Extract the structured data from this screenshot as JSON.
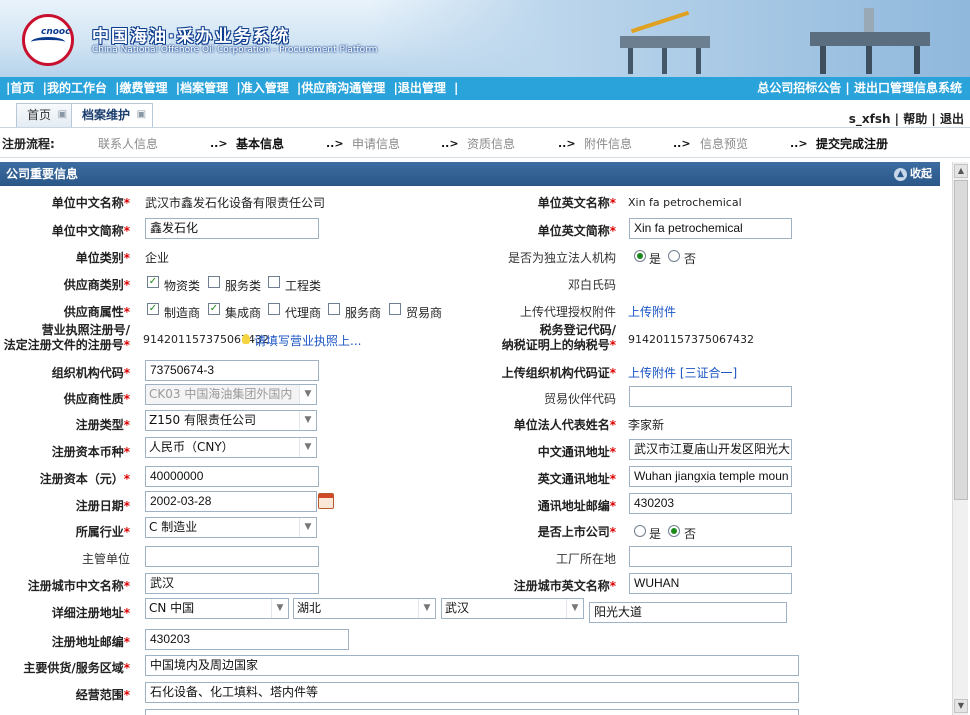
{
  "header": {
    "title_cn": "中国海油·采办业务系统",
    "title_en": "China National Offshore Oil Corporation - Procurement Platform",
    "logo_text": "cnooc"
  },
  "mainnav": {
    "left": [
      "|首页",
      "|我的工作台",
      "|缴费管理",
      "|档案管理",
      "|准入管理",
      "|供应商沟通管理",
      "|退出管理",
      "|"
    ],
    "right": "总公司招标公告 | 进出口管理信息系统"
  },
  "tabs": [
    {
      "label": "首页"
    },
    {
      "label": "档案维护"
    }
  ],
  "userbar": "s_xfsh | 帮助 | 退出",
  "steps": {
    "label": "注册流程:",
    "items": [
      "联系人信息",
      "基本信息",
      "申请信息",
      "资质信息",
      "附件信息",
      "信息预览",
      "提交完成注册"
    ],
    "arrow": "..>"
  },
  "panel": {
    "title": "公司重要信息",
    "collapse": "收起"
  },
  "form": {
    "cn_name_label": "单位中文名称",
    "cn_name_value": "武汉市鑫发石化设备有限责任公司",
    "en_name_label": "单位英文名称",
    "en_name_value": "Xin fa petrochemical",
    "cn_short_label": "单位中文简称",
    "cn_short_value": "鑫发石化",
    "en_short_label": "单位英文简称",
    "en_short_value": "Xin fa petrochemical",
    "unit_type_label": "单位类别",
    "unit_type_value": "企业",
    "independent_label": "是否为独立法人机构",
    "yes": "是",
    "no": "否",
    "supplier_type_label": "供应商类别",
    "type_material": "物资类",
    "type_service": "服务类",
    "type_engineering": "工程类",
    "dengbai_label": "邓白氏码",
    "supplier_attr_label": "供应商属性",
    "attr_manufacturer": "制造商",
    "attr_integrator": "集成商",
    "attr_agent": "代理商",
    "attr_service": "服务商",
    "attr_trade": "贸易商",
    "agent_upload_label": "上传代理授权附件",
    "upload_link": "上传附件",
    "license_label_1": "营业执照注册号/",
    "license_label_2": "法定注册文件的注册号",
    "license_value": "914201157375067432",
    "license_hint": "请填写营业执照上...",
    "tax_label_1": "税务登记代码/",
    "tax_label_2": "纳税证明上的纳税号",
    "tax_value": "914201157375067432",
    "org_code_label": "组织机构代码",
    "org_code_value": "73750674-3",
    "org_upload_label": "上传组织机构代码证",
    "org_upload_link": "上传附件 [三证合一]",
    "supplier_nature_label": "供应商性质",
    "supplier_nature_value": "CK03 中国海油集团外国内",
    "partner_code_label": "贸易伙伴代码",
    "reg_type_label": "注册类型",
    "reg_type_value": "Z150 有限责任公司",
    "legal_rep_label": "单位法人代表姓名",
    "legal_rep_value": "李家新",
    "currency_label": "注册资本币种",
    "currency_value": "人民币（CNY）",
    "cn_addr_label": "中文通讯地址",
    "cn_addr_value": "武汉市江夏庙山开发区阳光大",
    "capital_label": "注册资本（元）",
    "capital_value": "40000000",
    "en_addr_label": "英文通讯地址",
    "en_addr_value": "Wuhan jiangxia temple moun",
    "reg_date_label": "注册日期",
    "reg_date_value": "2002-03-28",
    "postcode_label": "通讯地址邮编",
    "postcode_value": "430203",
    "industry_label": "所属行业",
    "industry_value": "C 制造业",
    "listed_label": "是否上市公司",
    "authority_label": "主管单位",
    "factory_label": "工厂所在地",
    "city_cn_label": "注册城市中文名称",
    "city_cn_value": "武汉",
    "city_en_label": "注册城市英文名称",
    "city_en_value": "WUHAN",
    "detail_addr_label": "详细注册地址",
    "country_value": "CN 中国",
    "province_value": "湖北",
    "city_value": "武汉",
    "street_value": "阳光大道",
    "reg_postcode_label": "注册地址邮编",
    "reg_postcode_value": "430203",
    "main_area_label": "主要供货/服务区域",
    "main_area_value": "中国境内及周边国家",
    "scope_label": "经营范围",
    "scope_value": "石化设备、化工填料、塔内件等"
  }
}
